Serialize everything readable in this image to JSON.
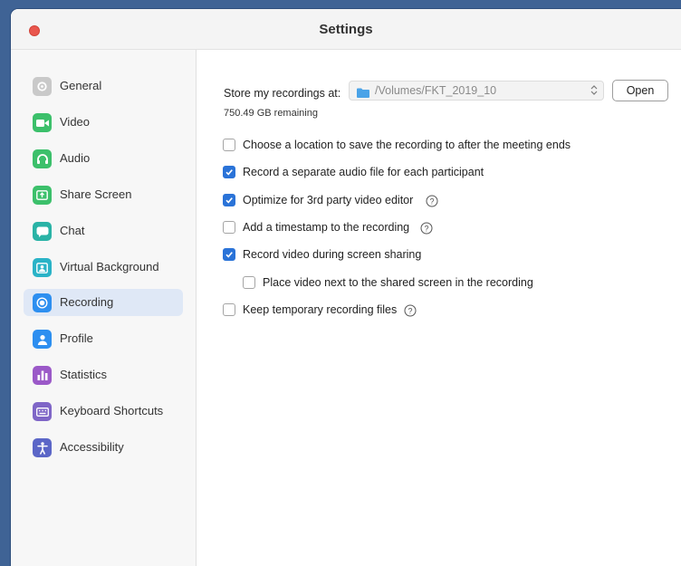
{
  "window": {
    "title": "Settings"
  },
  "sidebar": {
    "items": [
      {
        "label": "General",
        "icon": "gear-icon",
        "color": "#c7c7c7"
      },
      {
        "label": "Video",
        "icon": "video-camera-icon",
        "color": "#3cc06b"
      },
      {
        "label": "Audio",
        "icon": "headphones-icon",
        "color": "#3cc06b"
      },
      {
        "label": "Share Screen",
        "icon": "share-screen-icon",
        "color": "#3cc06b"
      },
      {
        "label": "Chat",
        "icon": "chat-bubble-icon",
        "color": "#2ab3a6"
      },
      {
        "label": "Virtual Background",
        "icon": "person-background-icon",
        "color": "#2ab3c7"
      },
      {
        "label": "Recording",
        "icon": "record-icon",
        "color": "#2d8ff0"
      },
      {
        "label": "Profile",
        "icon": "person-icon",
        "color": "#2d8ff0"
      },
      {
        "label": "Statistics",
        "icon": "bar-chart-icon",
        "color": "#9b59c8"
      },
      {
        "label": "Keyboard Shortcuts",
        "icon": "keyboard-icon",
        "color": "#7f66c7"
      },
      {
        "label": "Accessibility",
        "icon": "accessibility-icon",
        "color": "#5b66c7"
      }
    ],
    "active": "Recording"
  },
  "recording": {
    "store_label": "Store my recordings at:",
    "path": "/Volumes/FKT_2019_10",
    "open_label": "Open",
    "remaining": "750.49 GB remaining",
    "options": [
      {
        "label": "Choose a location to save the recording to after the meeting ends",
        "checked": false,
        "help": false
      },
      {
        "label": "Record a separate audio file for each participant",
        "checked": true,
        "help": false
      },
      {
        "label": "Optimize for 3rd party video editor",
        "checked": true,
        "help": true
      },
      {
        "label": "Add a timestamp to the recording",
        "checked": false,
        "help": true
      },
      {
        "label": "Record video during screen sharing",
        "checked": true,
        "help": false
      },
      {
        "label": "Place video next to the shared screen in the recording",
        "checked": false,
        "help": false
      },
      {
        "label": "Keep temporary recording files",
        "checked": false,
        "help": true
      }
    ]
  },
  "colors": {
    "accent": "#2a73d8",
    "active_bg": "#dfe8f6",
    "close": "#e9564d"
  }
}
